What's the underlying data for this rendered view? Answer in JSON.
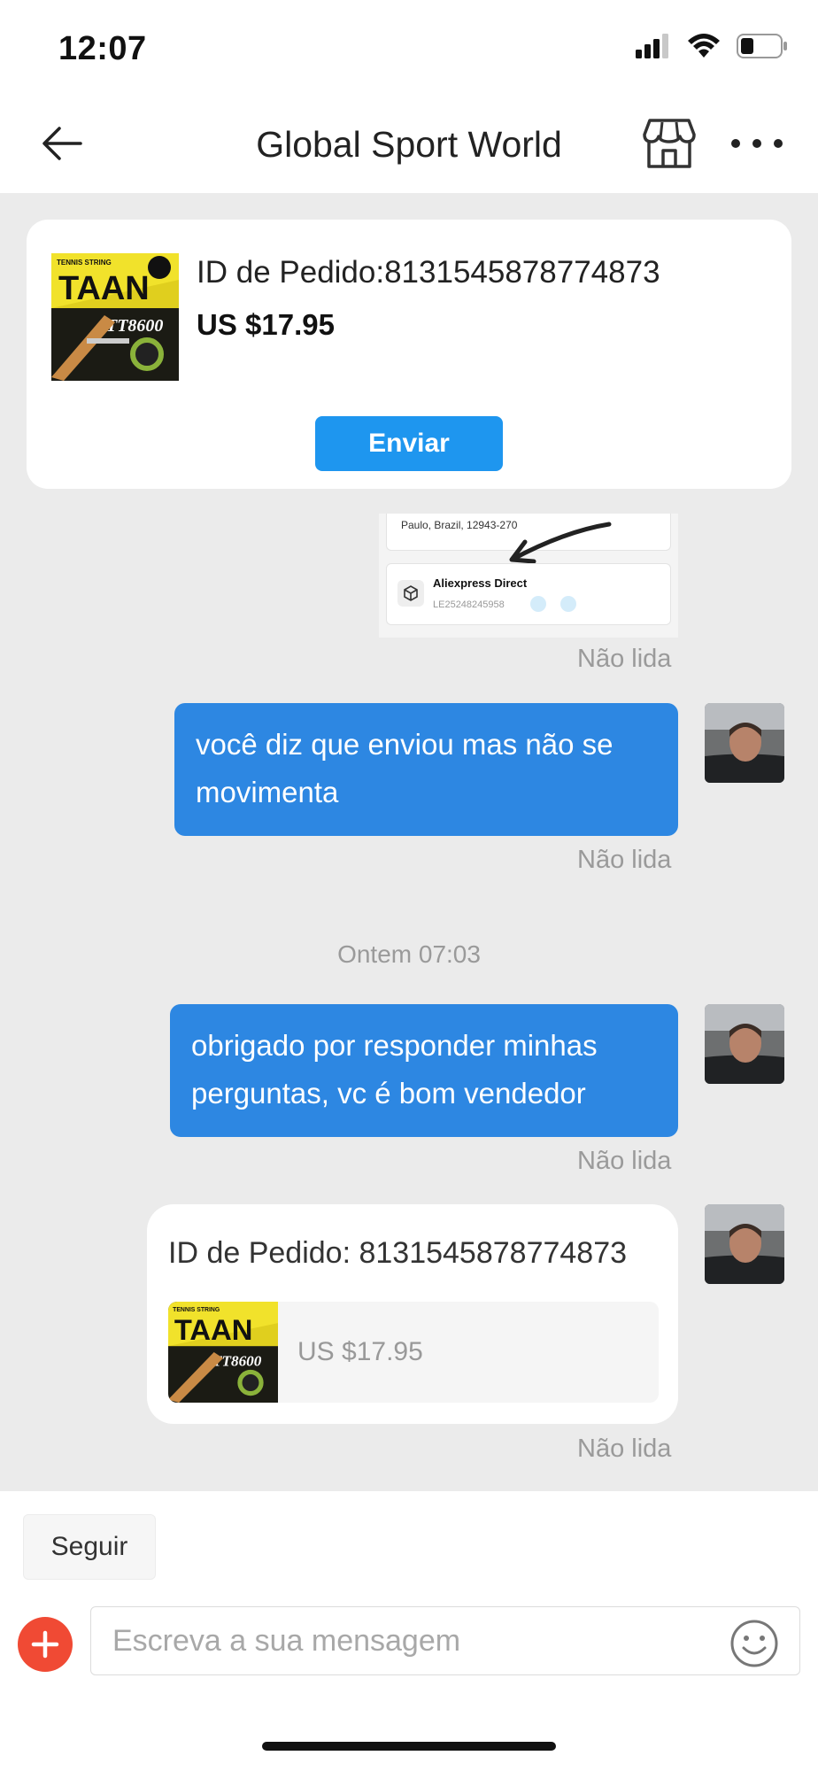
{
  "status_bar": {
    "time": "12:07"
  },
  "header": {
    "title": "Global Sport World"
  },
  "order_card": {
    "order_id_label": "ID de Pedido:8131545878774873",
    "price": "US $17.95",
    "send_label": "Enviar",
    "product_brand": "TAAN",
    "product_model": "TT8600",
    "product_top_text": "TENNIS STRING"
  },
  "screenshot_image": {
    "address_line": "Paulo, Brazil, 12943-270",
    "carrier": "Aliexpress Direct",
    "tracking": "LE25248245958"
  },
  "messages": [
    {
      "type": "image",
      "status": "Não lida"
    },
    {
      "type": "text",
      "text": "você diz que enviou mas não se movimenta",
      "status": "Não lida"
    },
    {
      "type": "timestamp",
      "text": "Ontem 07:03"
    },
    {
      "type": "text",
      "text": "obrigado por responder minhas perguntas, vc é bom vendedor",
      "status": "Não lida"
    },
    {
      "type": "order",
      "order_id": "ID de Pedido: 8131545878774873",
      "price": "US $17.95",
      "status": "Não lida"
    }
  ],
  "bottom_bar": {
    "follow_label": "Seguir",
    "input_placeholder": "Escreva a sua mensagem"
  },
  "colors": {
    "accent_blue": "#2d87e2",
    "send_button": "#1e96ef",
    "plus_button": "#f04a34",
    "chat_background": "#ebebeb"
  },
  "icons": [
    "back-arrow-icon",
    "store-icon",
    "more-icon",
    "plus-icon",
    "emoji-icon",
    "package-icon",
    "signal-icon",
    "wifi-icon",
    "battery-icon"
  ]
}
